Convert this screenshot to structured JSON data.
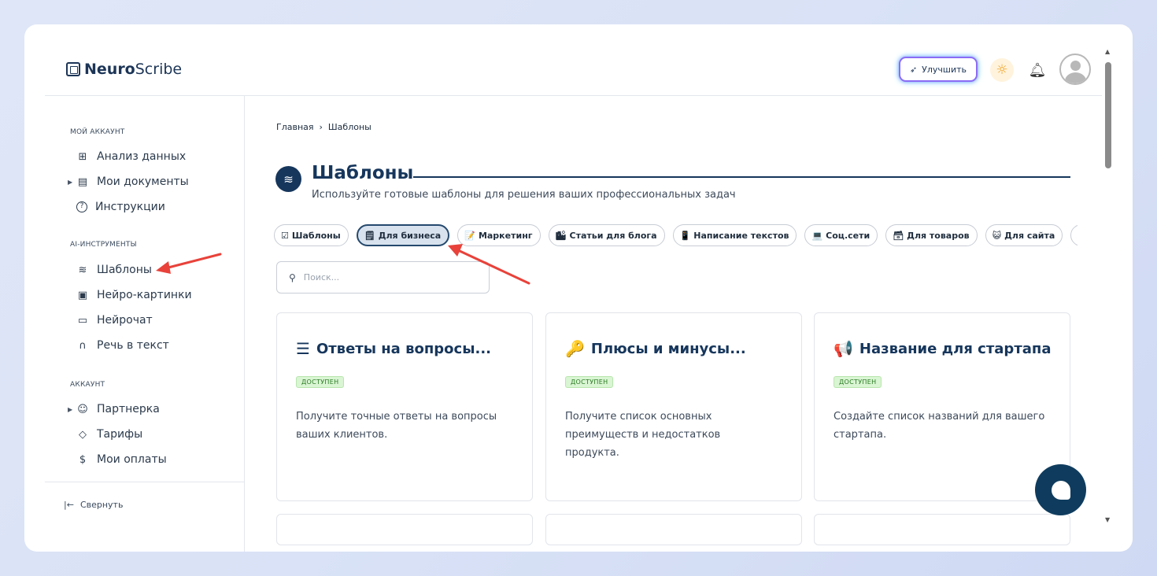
{
  "app": {
    "logo_bold": "Neuro",
    "logo_light": "Scribe"
  },
  "header": {
    "upgrade_label": "Улучшить",
    "upgrade_icon": "rocket-icon",
    "theme_icon": "sun-icon",
    "notification_icon": "bell-icon",
    "avatar_icon": "user-avatar"
  },
  "sidebar": {
    "sections": [
      {
        "title": "МОЙ АККАУНТ",
        "items": [
          {
            "label": "Анализ данных",
            "icon": "grid-icon",
            "glyph": "⊞"
          },
          {
            "label": "Мои документы",
            "icon": "document-icon",
            "glyph": "🗎",
            "expandable": true
          },
          {
            "label": "Инструкции",
            "icon": "help-icon",
            "glyph": "?"
          }
        ]
      },
      {
        "title": "AI-ИНСТРУМЕНТЫ",
        "items": [
          {
            "label": "Шаблоны",
            "icon": "layers-icon",
            "glyph": "≋"
          },
          {
            "label": "Нейро-картинки",
            "icon": "image-icon",
            "glyph": "▣"
          },
          {
            "label": "Нейрочат",
            "icon": "chat-icon",
            "glyph": "▭"
          },
          {
            "label": "Речь в текст",
            "icon": "headphones-icon",
            "glyph": "∩"
          }
        ]
      },
      {
        "title": "АККАУНТ",
        "items": [
          {
            "label": "Партнерка",
            "icon": "users-icon",
            "glyph": "☺",
            "expandable": true
          },
          {
            "label": "Тарифы",
            "icon": "tag-icon",
            "glyph": "◇"
          },
          {
            "label": "Мои оплаты",
            "icon": "dollar-icon",
            "glyph": "$"
          }
        ]
      }
    ],
    "collapse_label": "Свернуть"
  },
  "breadcrumb": {
    "home": "Главная",
    "separator": "›",
    "current": "Шаблоны"
  },
  "page": {
    "title": "Шаблоны",
    "subtitle": "Используйте готовые шаблоны для решения ваших профессиональных задач"
  },
  "chips": [
    {
      "label": "Шаблоны",
      "emoji": "☑",
      "active": false
    },
    {
      "label": "Для бизнеса",
      "emoji": "🗒",
      "active": true
    },
    {
      "label": "Маркетинг",
      "emoji": "📝",
      "active": false
    },
    {
      "label": "Статьи для блога",
      "emoji": "🏙",
      "active": false
    },
    {
      "label": "Написание текстов",
      "emoji": "📱",
      "active": false
    },
    {
      "label": "Соц.сети",
      "emoji": "💻",
      "active": false
    },
    {
      "label": "Для товаров",
      "emoji": "🗃",
      "active": false
    },
    {
      "label": "Для сайта",
      "emoji": "😺",
      "active": false
    },
    {
      "label": "",
      "emoji": "",
      "active": false
    }
  ],
  "search": {
    "placeholder": "Поиск..."
  },
  "cards": [
    {
      "emoji": "☰",
      "title": "Ответы на вопросы...",
      "badge": "ДОСТУПЕН",
      "desc": "Получите точные ответы на вопросы ваших клиентов."
    },
    {
      "emoji": "🔑",
      "title": "Плюсы и минусы...",
      "badge": "ДОСТУПЕН",
      "desc": "Получите список основных преимуществ и недостатков продукта."
    },
    {
      "emoji": "📢",
      "title": "Название для стартапа",
      "badge": "ДОСТУПЕН",
      "desc": "Создайте список названий для вашего стартапа."
    }
  ],
  "colors": {
    "primary": "#16365c",
    "badge_bg": "#d9f5d3",
    "badge_text": "#2b7a23",
    "annotation_arrow": "#e8423a"
  }
}
